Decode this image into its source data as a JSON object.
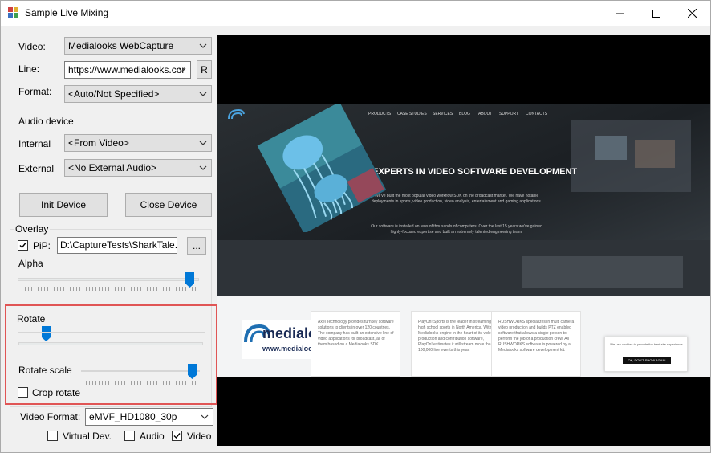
{
  "window": {
    "title": "Sample Live Mixing"
  },
  "controls": {
    "video_label": "Video:",
    "video_value": "Medialooks WebCapture",
    "line_label": "Line:",
    "line_value": "https://www.medialooks.cor",
    "refresh_label": "R",
    "format_label": "Format:",
    "format_value": "<Auto/Not Specified>",
    "audio_device_label": "Audio device",
    "internal_label": "Internal",
    "internal_value": "<From Video>",
    "external_label": "External",
    "external_value": "<No External Audio>",
    "init_button": "Init Device",
    "close_button": "Close Device"
  },
  "overlay": {
    "group_label": "Overlay",
    "pip_label": "PiP:",
    "pip_checked": true,
    "pip_path": "D:\\CaptureTests\\SharkTale.avi",
    "browse_label": "...",
    "alpha_label": "Alpha",
    "alpha_level": 0.97,
    "rotate_label": "Rotate",
    "rotate_level": 0.13,
    "rotate_scale_label": "Rotate scale",
    "rotate_scale_level": 0.97,
    "crop_rotate_label": "Crop rotate",
    "crop_rotate_checked": false
  },
  "output": {
    "video_format_label": "Video Format:",
    "video_format_value": "eMVF_HD1080_30p",
    "virtual_dev_label": "Virtual Dev.",
    "virtual_dev_checked": false,
    "audio_label": "Audio",
    "audio_checked": false,
    "video_label": "Video",
    "video_checked": true
  },
  "preview": {
    "nav": [
      "PRODUCTS",
      "CASE STUDIES",
      "SERVICES",
      "BLOG",
      "ABOUT",
      "SUPPORT",
      "CONTACTS"
    ],
    "headline": "ARE EXPERTS IN VIDEO SOFTWARE DEVELOPMENT",
    "para1": "We've built the most popular video workflow SDK on the broadcast market. We have notable deployments in sports, video production, video analysis, entertainment and gaming applications.",
    "para2": "Our software is installed on tens of thousands of computers. Over the last 15 years we've gained highly-focused expertise and built an extremely talented engineering team.",
    "logo_text": "medialooks",
    "logo_url": "www.medialooks.com",
    "cards": [
      "Axel Technology provides turnkey software solutions to clients in over 120 countries. The company has built an extensive line of video applications for broadcast, all of them based on a Medialooks SDK.",
      "PlayOn! Sports is the leader in streaming high school sports in North America. With a Medialooks engine in the heart of its video production and contribution software, PlayOn! estimates it will stream more than 100,000 live events this year.",
      "RUSHWORKS specializes in multi camera video production and builds PTZ enabled software that allows a single person to perform the job of a production crew. All RUSHWORKS software is powered by a Medialooks software development kit."
    ],
    "cookie_text": "We use cookies to provide the best site experience.",
    "cookie_button": "OK, DON'T SHOW AGAIN"
  }
}
